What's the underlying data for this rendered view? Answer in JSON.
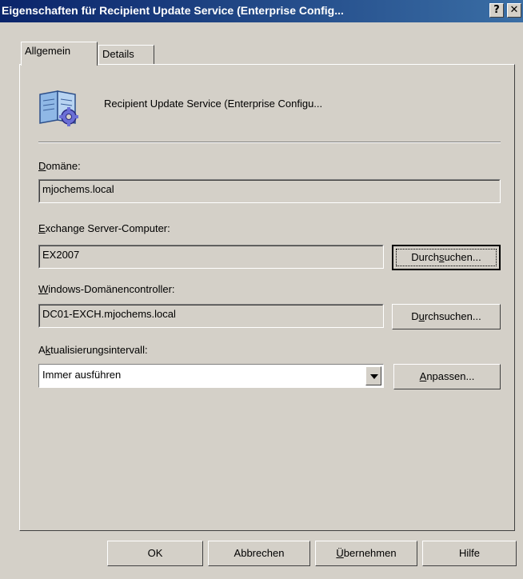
{
  "window": {
    "title": "Eigenschaften für Recipient Update Service (Enterprise Config...",
    "help_button": "?",
    "close_button": "✕"
  },
  "tabs": [
    {
      "label": "Allgemein",
      "active": true
    },
    {
      "label": "Details",
      "active": false
    }
  ],
  "header": {
    "icon": "book-gear-icon",
    "name": "Recipient Update Service (Enterprise Configu..."
  },
  "fields": {
    "domain": {
      "label_u": "D",
      "label_rest": "omäne:",
      "value": "mjochems.local"
    },
    "exchange": {
      "label_u": "E",
      "label_rest": "xchange Server-Computer:",
      "value": "EX2007",
      "browse_pre": "Durch",
      "browse_u": "s",
      "browse_post": "uchen..."
    },
    "dc": {
      "label_u": "W",
      "label_rest": "indows-Domänencontroller:",
      "value": "DC01-EXCH.mjochems.local",
      "browse_pre": "D",
      "browse_u": "u",
      "browse_post": "rchsuchen..."
    },
    "interval": {
      "label_pre": "A",
      "label_u": "k",
      "label_rest": "tualisierungsintervall:",
      "value": "Immer ausführen",
      "customize_u": "A",
      "customize_rest": "npassen..."
    }
  },
  "footer": {
    "ok": "OK",
    "cancel": "Abbrechen",
    "apply_u": "Ü",
    "apply_rest": "bernehmen",
    "help": "Hilfe"
  }
}
